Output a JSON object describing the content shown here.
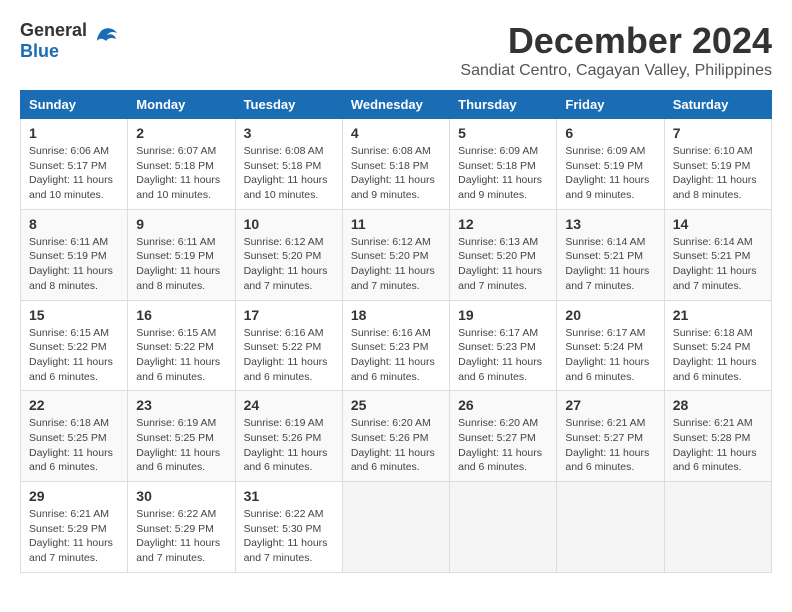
{
  "logo": {
    "general": "General",
    "blue": "Blue"
  },
  "title": {
    "month": "December 2024",
    "location": "Sandiat Centro, Cagayan Valley, Philippines"
  },
  "weekdays": [
    "Sunday",
    "Monday",
    "Tuesday",
    "Wednesday",
    "Thursday",
    "Friday",
    "Saturday"
  ],
  "weeks": [
    [
      {
        "day": "1",
        "sunrise": "6:06 AM",
        "sunset": "5:17 PM",
        "daylight": "11 hours and 10 minutes."
      },
      {
        "day": "2",
        "sunrise": "6:07 AM",
        "sunset": "5:18 PM",
        "daylight": "11 hours and 10 minutes."
      },
      {
        "day": "3",
        "sunrise": "6:08 AM",
        "sunset": "5:18 PM",
        "daylight": "11 hours and 10 minutes."
      },
      {
        "day": "4",
        "sunrise": "6:08 AM",
        "sunset": "5:18 PM",
        "daylight": "11 hours and 9 minutes."
      },
      {
        "day": "5",
        "sunrise": "6:09 AM",
        "sunset": "5:18 PM",
        "daylight": "11 hours and 9 minutes."
      },
      {
        "day": "6",
        "sunrise": "6:09 AM",
        "sunset": "5:19 PM",
        "daylight": "11 hours and 9 minutes."
      },
      {
        "day": "7",
        "sunrise": "6:10 AM",
        "sunset": "5:19 PM",
        "daylight": "11 hours and 8 minutes."
      }
    ],
    [
      {
        "day": "8",
        "sunrise": "6:11 AM",
        "sunset": "5:19 PM",
        "daylight": "11 hours and 8 minutes."
      },
      {
        "day": "9",
        "sunrise": "6:11 AM",
        "sunset": "5:19 PM",
        "daylight": "11 hours and 8 minutes."
      },
      {
        "day": "10",
        "sunrise": "6:12 AM",
        "sunset": "5:20 PM",
        "daylight": "11 hours and 7 minutes."
      },
      {
        "day": "11",
        "sunrise": "6:12 AM",
        "sunset": "5:20 PM",
        "daylight": "11 hours and 7 minutes."
      },
      {
        "day": "12",
        "sunrise": "6:13 AM",
        "sunset": "5:20 PM",
        "daylight": "11 hours and 7 minutes."
      },
      {
        "day": "13",
        "sunrise": "6:14 AM",
        "sunset": "5:21 PM",
        "daylight": "11 hours and 7 minutes."
      },
      {
        "day": "14",
        "sunrise": "6:14 AM",
        "sunset": "5:21 PM",
        "daylight": "11 hours and 7 minutes."
      }
    ],
    [
      {
        "day": "15",
        "sunrise": "6:15 AM",
        "sunset": "5:22 PM",
        "daylight": "11 hours and 6 minutes."
      },
      {
        "day": "16",
        "sunrise": "6:15 AM",
        "sunset": "5:22 PM",
        "daylight": "11 hours and 6 minutes."
      },
      {
        "day": "17",
        "sunrise": "6:16 AM",
        "sunset": "5:22 PM",
        "daylight": "11 hours and 6 minutes."
      },
      {
        "day": "18",
        "sunrise": "6:16 AM",
        "sunset": "5:23 PM",
        "daylight": "11 hours and 6 minutes."
      },
      {
        "day": "19",
        "sunrise": "6:17 AM",
        "sunset": "5:23 PM",
        "daylight": "11 hours and 6 minutes."
      },
      {
        "day": "20",
        "sunrise": "6:17 AM",
        "sunset": "5:24 PM",
        "daylight": "11 hours and 6 minutes."
      },
      {
        "day": "21",
        "sunrise": "6:18 AM",
        "sunset": "5:24 PM",
        "daylight": "11 hours and 6 minutes."
      }
    ],
    [
      {
        "day": "22",
        "sunrise": "6:18 AM",
        "sunset": "5:25 PM",
        "daylight": "11 hours and 6 minutes."
      },
      {
        "day": "23",
        "sunrise": "6:19 AM",
        "sunset": "5:25 PM",
        "daylight": "11 hours and 6 minutes."
      },
      {
        "day": "24",
        "sunrise": "6:19 AM",
        "sunset": "5:26 PM",
        "daylight": "11 hours and 6 minutes."
      },
      {
        "day": "25",
        "sunrise": "6:20 AM",
        "sunset": "5:26 PM",
        "daylight": "11 hours and 6 minutes."
      },
      {
        "day": "26",
        "sunrise": "6:20 AM",
        "sunset": "5:27 PM",
        "daylight": "11 hours and 6 minutes."
      },
      {
        "day": "27",
        "sunrise": "6:21 AM",
        "sunset": "5:27 PM",
        "daylight": "11 hours and 6 minutes."
      },
      {
        "day": "28",
        "sunrise": "6:21 AM",
        "sunset": "5:28 PM",
        "daylight": "11 hours and 6 minutes."
      }
    ],
    [
      {
        "day": "29",
        "sunrise": "6:21 AM",
        "sunset": "5:29 PM",
        "daylight": "11 hours and 7 minutes."
      },
      {
        "day": "30",
        "sunrise": "6:22 AM",
        "sunset": "5:29 PM",
        "daylight": "11 hours and 7 minutes."
      },
      {
        "day": "31",
        "sunrise": "6:22 AM",
        "sunset": "5:30 PM",
        "daylight": "11 hours and 7 minutes."
      },
      null,
      null,
      null,
      null
    ]
  ]
}
